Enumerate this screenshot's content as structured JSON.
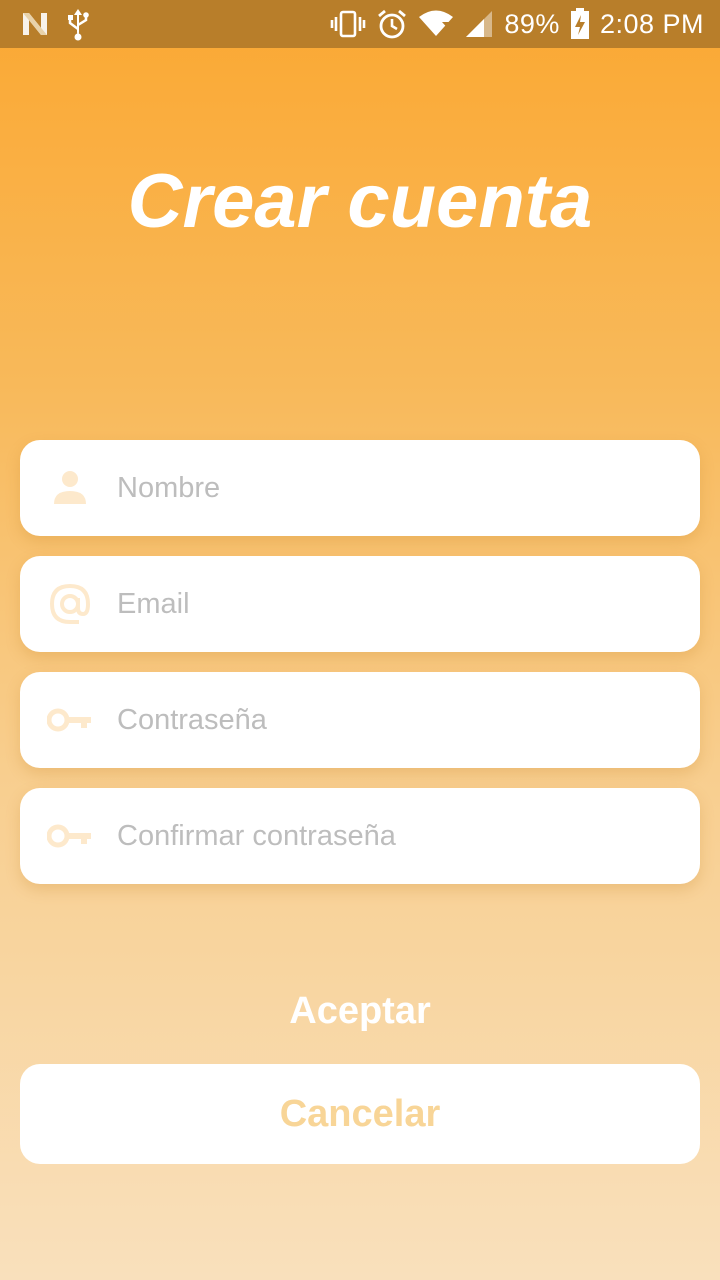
{
  "status_bar": {
    "battery": "89%",
    "time": "2:08 PM",
    "icons": [
      "n-notification-icon",
      "usb-icon",
      "vibrate-icon",
      "alarm-icon",
      "wifi-icon",
      "signal-icon",
      "battery-charging-icon"
    ]
  },
  "title": "Crear cuenta",
  "fields": [
    {
      "icon": "person-icon",
      "placeholder": "Nombre"
    },
    {
      "icon": "at-icon",
      "placeholder": "Email"
    },
    {
      "icon": "key-icon",
      "placeholder": "Contraseña"
    },
    {
      "icon": "key-icon",
      "placeholder": "Confirmar contraseña"
    }
  ],
  "buttons": {
    "accept": "Aceptar",
    "cancel": "Cancelar"
  },
  "colors": {
    "status_bar": "#B87E2A",
    "gradient_top": "#FBA832",
    "gradient_bottom": "#F9E0BC",
    "icon_tint": "#FDE9CC",
    "cancel_text": "#F8D597",
    "placeholder": "#BDBDBD"
  }
}
